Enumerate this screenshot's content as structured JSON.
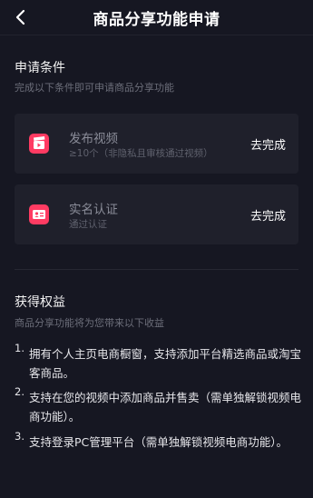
{
  "header": {
    "back_icon": "chevron-left-icon",
    "title": "商品分享功能申请"
  },
  "conditions": {
    "title": "申请条件",
    "subtitle": "完成以下条件即可申请商品分享功能",
    "items": [
      {
        "icon": "video-clapper-icon",
        "name": "发布视频",
        "desc": "≥10个（非隐私且审核通过视频）",
        "action": "去完成"
      },
      {
        "icon": "id-card-icon",
        "name": "实名认证",
        "desc": "通过认证",
        "action": "去完成"
      }
    ]
  },
  "benefits": {
    "title": "获得权益",
    "subtitle": "商品分享功能将为您带来以下收益",
    "items": [
      {
        "num": "1.",
        "text": "拥有个人主页电商橱窗，支持添加平台精选商品或淘宝客商品。"
      },
      {
        "num": "2.",
        "text": "支持在您的视频中添加商品并售卖（需单独解锁视频电商功能）。"
      },
      {
        "num": "3.",
        "text": "支持登录PC管理平台（需单独解锁视频电商功能）。"
      }
    ]
  },
  "colors": {
    "accent": "#ff3b62",
    "background": "#161722",
    "card": "#1f202b"
  }
}
